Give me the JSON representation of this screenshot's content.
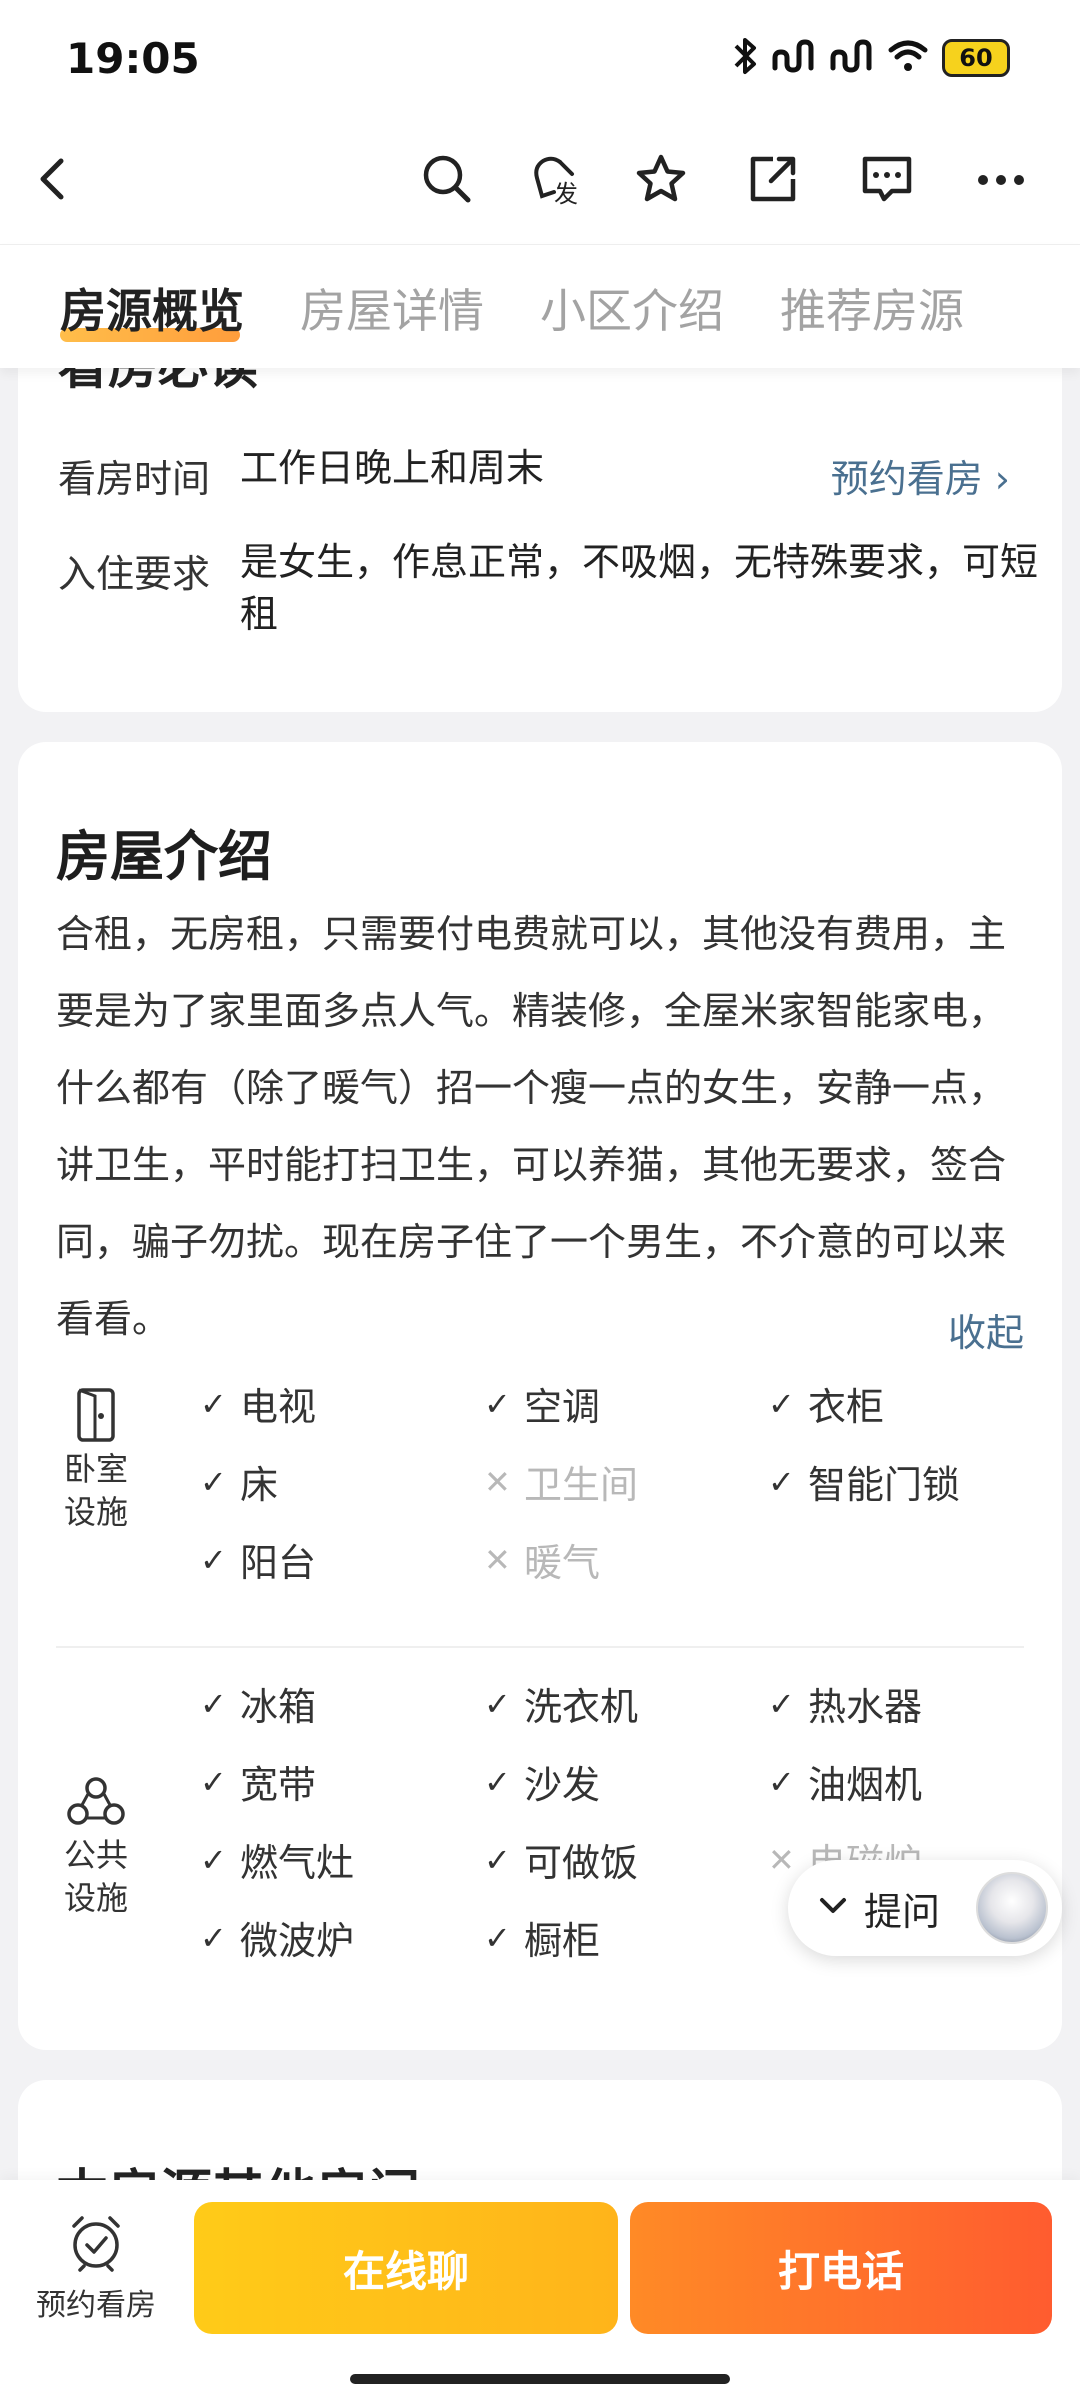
{
  "status_bar": {
    "time": "19:05",
    "battery": "60"
  },
  "tabs": [
    {
      "label": "房源概览",
      "active": true
    },
    {
      "label": "房屋详情",
      "active": false
    },
    {
      "label": "小区介绍",
      "active": false
    },
    {
      "label": "推荐房源",
      "active": false
    }
  ],
  "viewing_card": {
    "cut_title": "看房必读",
    "rows": [
      {
        "label": "看房时间",
        "value": "工作日晚上和周末",
        "link": "预约看房 ›"
      },
      {
        "label": "入住要求",
        "value": "是女生，作息正常，不吸烟，无特殊要求，可短租"
      }
    ]
  },
  "intro": {
    "title": "房屋介绍",
    "description": "合租，无房租，只需要付电费就可以，其他没有费用，主要是为了家里面多点人气。精装修，全屋米家智能家电，什么都有（除了暖气）招一个瘦一点的女生，安静一点，讲卫生，平时能打扫卫生，可以养猫，其他无要求，签合同，骗子勿扰。现在房子住了一个男生，不介意的可以来看看。",
    "collapse": "收起",
    "bedroom": {
      "category_line1": "卧室",
      "category_line2": "设施",
      "items": [
        {
          "label": "电视",
          "available": true
        },
        {
          "label": "空调",
          "available": true
        },
        {
          "label": "衣柜",
          "available": true
        },
        {
          "label": "床",
          "available": true
        },
        {
          "label": "卫生间",
          "available": false
        },
        {
          "label": "智能门锁",
          "available": true
        },
        {
          "label": "阳台",
          "available": true
        },
        {
          "label": "暖气",
          "available": false
        }
      ]
    },
    "public": {
      "category_line1": "公共",
      "category_line2": "设施",
      "items": [
        {
          "label": "冰箱",
          "available": true
        },
        {
          "label": "洗衣机",
          "available": true
        },
        {
          "label": "热水器",
          "available": true
        },
        {
          "label": "宽带",
          "available": true
        },
        {
          "label": "沙发",
          "available": true
        },
        {
          "label": "油烟机",
          "available": true
        },
        {
          "label": "燃气灶",
          "available": true
        },
        {
          "label": "可做饭",
          "available": true
        },
        {
          "label": "电磁炉",
          "available": false
        },
        {
          "label": "微波炉",
          "available": true
        },
        {
          "label": "橱柜",
          "available": true
        }
      ]
    }
  },
  "other_rooms": {
    "title": "本房源其他房间"
  },
  "ask": {
    "label": "提问"
  },
  "bottom": {
    "appointment": "预约看房",
    "chat": "在线聊",
    "call": "打电话"
  },
  "colors": {
    "link": "#4a7090",
    "chat_button": "#ffc21a",
    "call_button": "#ff6f2b"
  },
  "icons": [
    "back-icon",
    "search-icon",
    "publish-icon",
    "star-icon",
    "share-icon",
    "message-icon",
    "more-icon",
    "door-icon",
    "people-icon",
    "alarm-clock-icon"
  ]
}
